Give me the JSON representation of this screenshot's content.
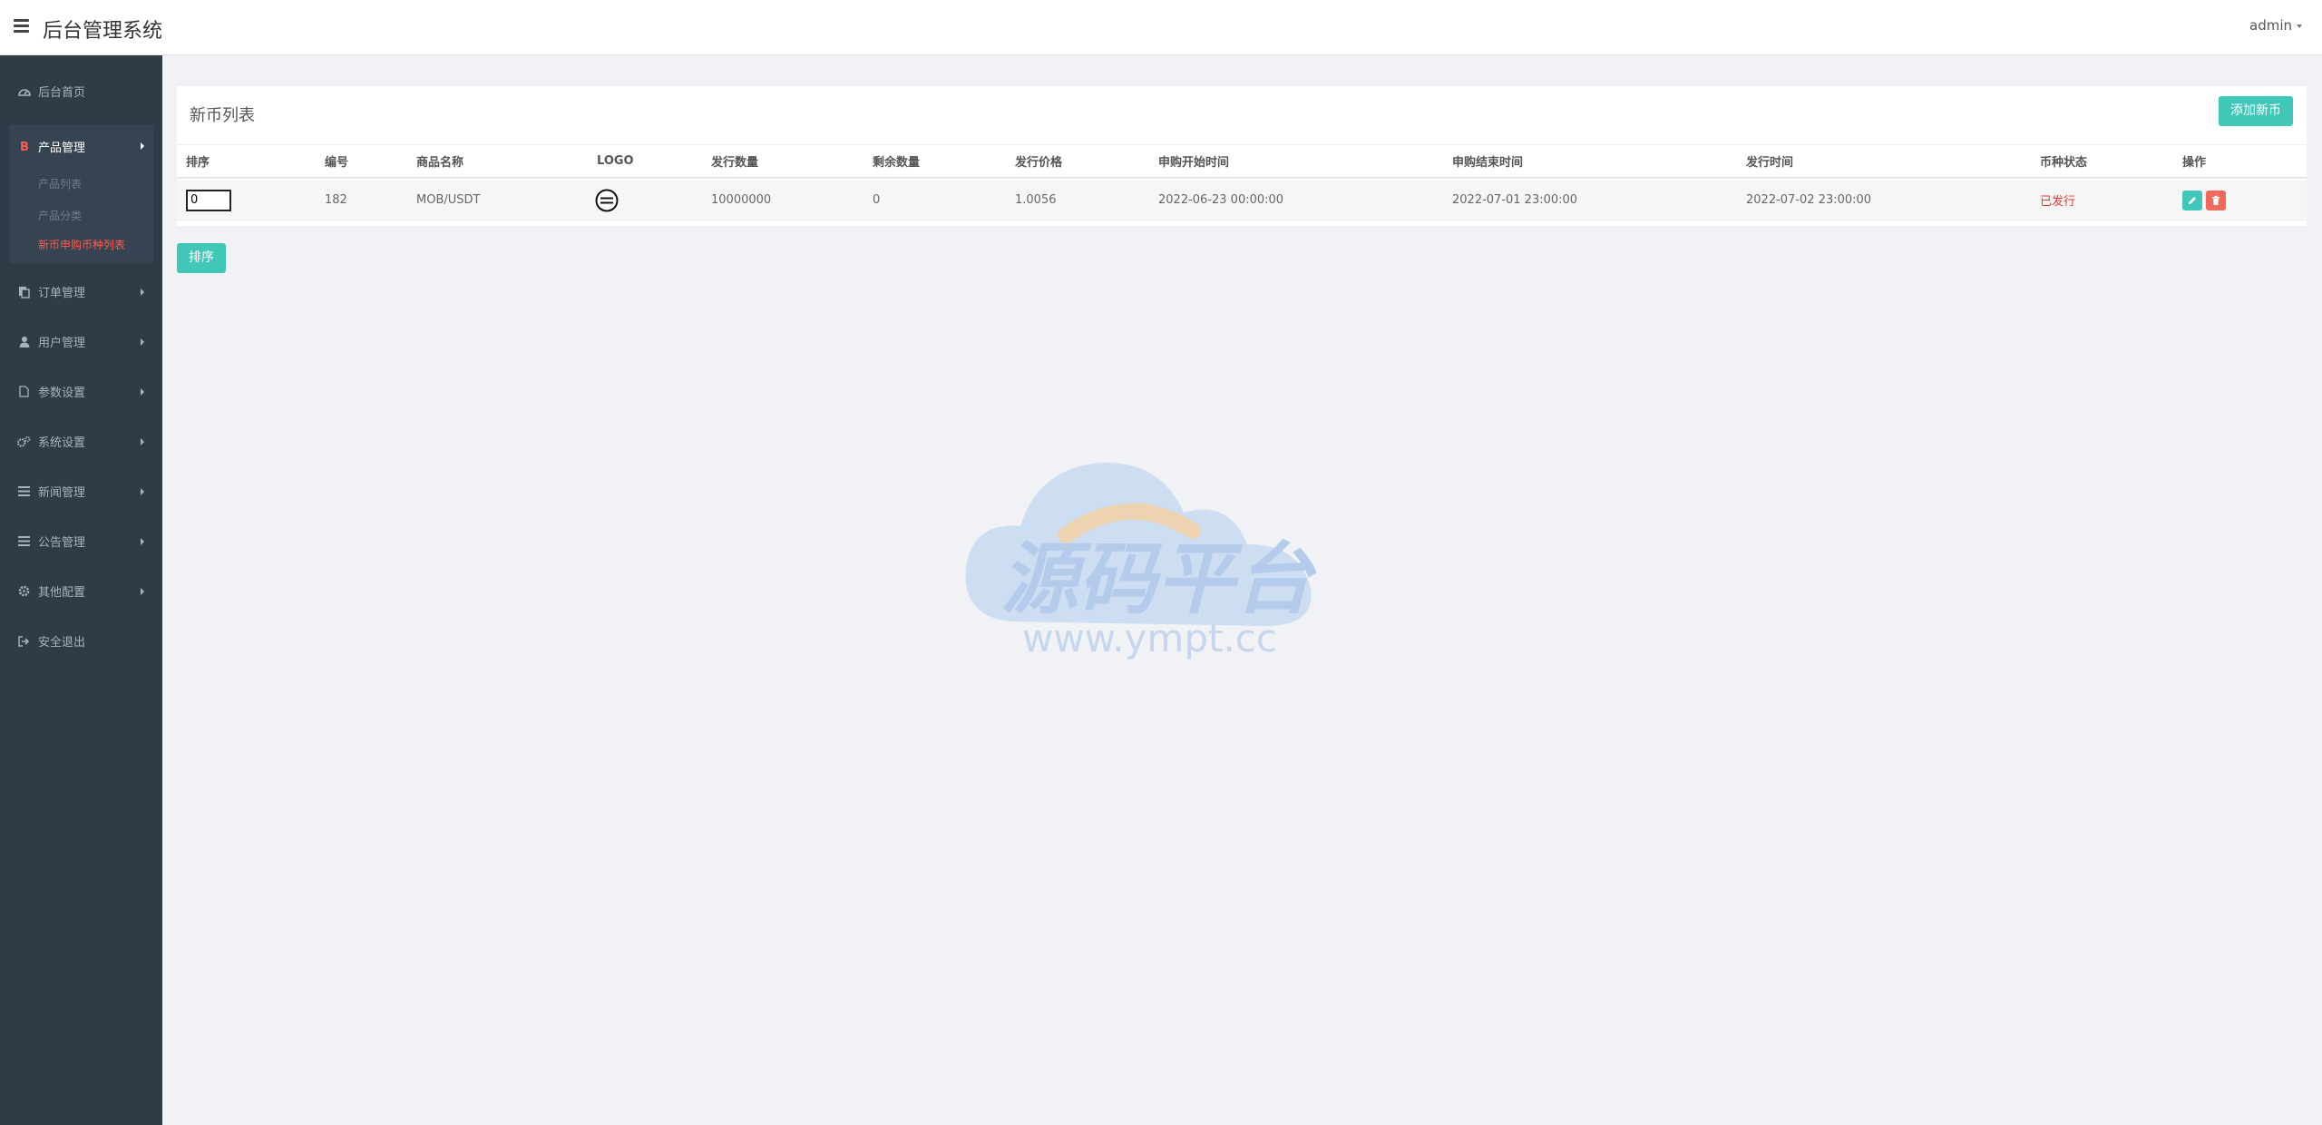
{
  "header": {
    "title": "后台管理系统",
    "user": "admin"
  },
  "sidebar": {
    "items": [
      {
        "label": "后台首页",
        "icon": "dashboard-icon"
      },
      {
        "label": "产品管理",
        "icon": "bitcoin-icon",
        "open": true,
        "children": [
          {
            "label": "产品列表"
          },
          {
            "label": "产品分类"
          },
          {
            "label": "新币申购币种列表",
            "active": true
          }
        ]
      },
      {
        "label": "订单管理",
        "icon": "copy-icon"
      },
      {
        "label": "用户管理",
        "icon": "user-icon"
      },
      {
        "label": "参数设置",
        "icon": "file-icon"
      },
      {
        "label": "系统设置",
        "icon": "gears-icon"
      },
      {
        "label": "新闻管理",
        "icon": "list-icon"
      },
      {
        "label": "公告管理",
        "icon": "list-icon"
      },
      {
        "label": "其他配置",
        "icon": "gear-icon"
      },
      {
        "label": "安全退出",
        "icon": "sign-out-icon"
      }
    ]
  },
  "panel": {
    "title": "新币列表",
    "add_button": "添加新币",
    "sort_button": "排序"
  },
  "table": {
    "columns": [
      "排序",
      "编号",
      "商品名称",
      "LOGO",
      "发行数量",
      "剩余数量",
      "发行价格",
      "申购开始时间",
      "申购结束时间",
      "发行时间",
      "币种状态",
      "操作"
    ],
    "rows": [
      {
        "sort": "0",
        "id": "182",
        "name": "MOB/USDT",
        "logo": "mob-coin-logo",
        "issue_qty": "10000000",
        "remaining_qty": "0",
        "issue_price": "1.0056",
        "start_time": "2022-06-23 00:00:00",
        "end_time": "2022-07-01 23:00:00",
        "issue_time": "2022-07-02 23:00:00",
        "status": "已发行"
      }
    ]
  },
  "watermark": {
    "text": "源码平台",
    "url": "www.ympt.cc"
  },
  "colors": {
    "sidebar_bg": "#2f3b46",
    "accent": "#40c7b8",
    "danger": "#f1685c",
    "active_link": "#ff5b50"
  }
}
